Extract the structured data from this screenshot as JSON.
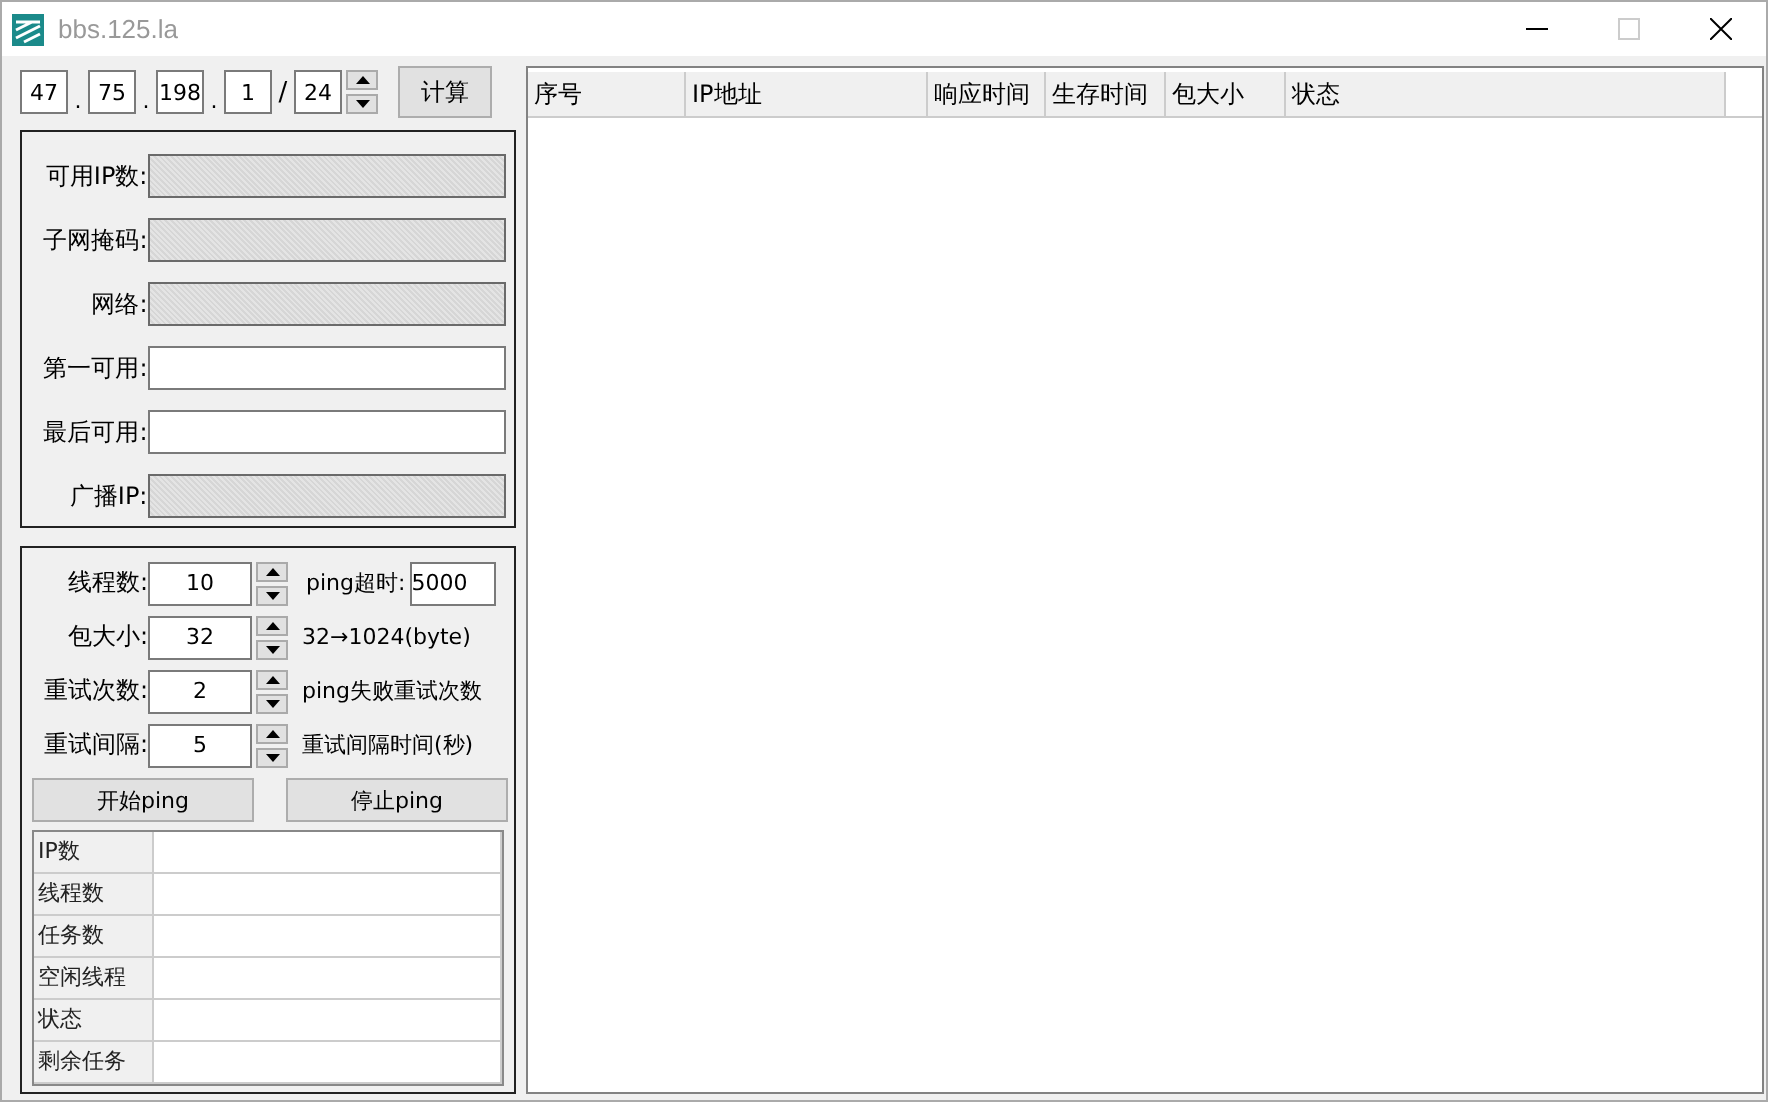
{
  "window": {
    "title": "bbs.125.la",
    "controls": [
      {
        "kind": "minimize",
        "disabled": false
      },
      {
        "kind": "maximize",
        "disabled": true
      },
      {
        "kind": "close",
        "disabled": false
      }
    ]
  },
  "ip": {
    "octets": [
      "47",
      "75",
      "198",
      "1"
    ],
    "separator": ".",
    "slash": "/",
    "prefix": "24",
    "button": "计算"
  },
  "results": [
    {
      "label": "可用IP数:",
      "disabled": true
    },
    {
      "label": "子网掩码:",
      "disabled": true
    },
    {
      "label": "网络:",
      "disabled": true
    },
    {
      "label": "第一可用:",
      "disabled": false
    },
    {
      "label": "最后可用:",
      "disabled": false
    },
    {
      "label": "广播IP:",
      "disabled": true
    }
  ],
  "settings": [
    {
      "label": "线程数:",
      "value": "10",
      "aside": {
        "kind": "field",
        "label": "ping超时:",
        "value": "5000"
      }
    },
    {
      "label": "包大小:",
      "value": "32",
      "aside": {
        "kind": "text",
        "text": "32→1024(byte)"
      }
    },
    {
      "label": "重试次数:",
      "value": "2",
      "aside": {
        "kind": "text",
        "text": "ping失败重试次数"
      }
    },
    {
      "label": "重试间隔:",
      "value": "5",
      "aside": {
        "kind": "text",
        "text": "重试间隔时间(秒)"
      }
    }
  ],
  "buttons": [
    "开始ping",
    "停止ping"
  ],
  "stats": [
    "IP数",
    "线程数",
    "任务数",
    "空闲线程",
    "状态",
    "剩余任务"
  ],
  "table": {
    "columns": [
      "序号",
      "IP地址",
      "响应时间",
      "生存时间",
      "包大小",
      "状态"
    ]
  }
}
